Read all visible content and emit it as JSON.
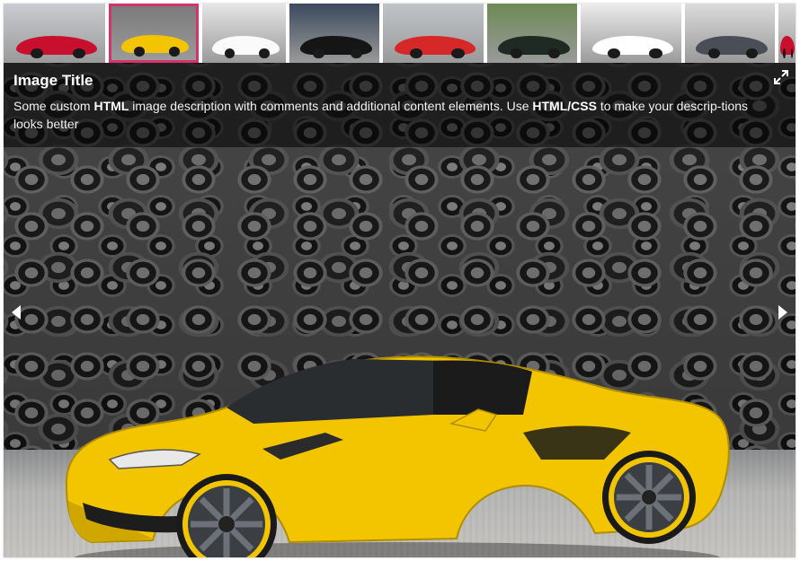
{
  "gallery": {
    "thumbnails": [
      {
        "name": "red-car-thumbnail",
        "bg": "#c9ccd0",
        "car": "#c8102e",
        "active": false
      },
      {
        "name": "yellow-car-thumbnail",
        "bg": "#7b7b7b",
        "car": "#f2c500",
        "active": true
      },
      {
        "name": "white-car-thumbnail",
        "bg": "#e6e6e6",
        "car": "#fafafa",
        "active": false
      },
      {
        "name": "black-car-sunset-thumbnail",
        "bg": "#3b4a5d",
        "car": "#151515",
        "active": false
      },
      {
        "name": "car-lineup-thumbnail",
        "bg": "#bfc4c8",
        "car": "#d62828",
        "active": false
      },
      {
        "name": "dark-car-road-thumbnail",
        "bg": "#6e8a55",
        "car": "#1f2a25",
        "active": false
      },
      {
        "name": "white-car-studio-thumbnail",
        "bg": "#ececec",
        "car": "#ffffff",
        "active": false
      },
      {
        "name": "grey-car-thumbnail",
        "bg": "#dcdcdc",
        "car": "#4a4f57",
        "active": false
      },
      {
        "name": "red-car-partial-thumbnail",
        "bg": "#d9d9d9",
        "car": "#c8102e",
        "active": false
      }
    ],
    "accent_color": "#d6336c"
  },
  "caption": {
    "title": "Image Title",
    "desc_prefix": "Some custom ",
    "desc_bold1": "HTML",
    "desc_mid": " image description with comments and additional content elements. Use ",
    "desc_bold2": "HTML/CSS",
    "desc_suffix": " to make your descrip-tions looks better"
  },
  "controls": {
    "fullscreen_icon": "fullscreen-icon",
    "prev_icon": "arrow-left-icon",
    "next_icon": "arrow-right-icon"
  }
}
